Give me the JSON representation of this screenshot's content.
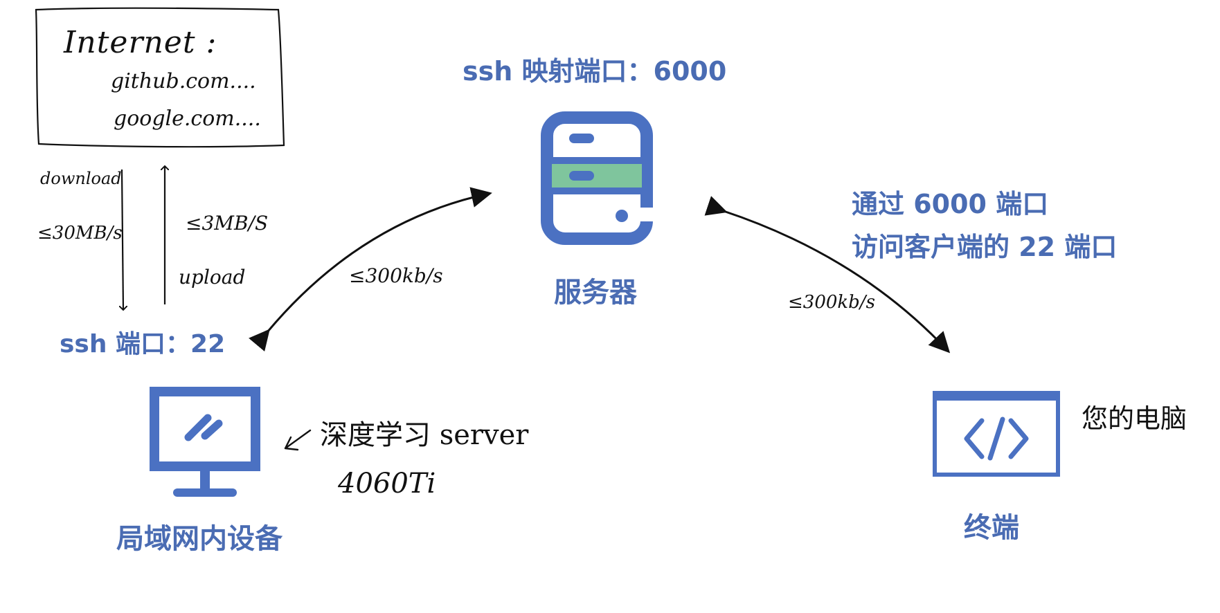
{
  "internet_box": {
    "title": "Internet :",
    "sites": [
      "github.com....",
      "google.com...."
    ]
  },
  "links": {
    "download_label": "download",
    "download_speed": "≤30MB/s",
    "upload_speed": "≤3MB/S",
    "upload_label": "upload",
    "left_link_speed": "≤300kb/s",
    "right_link_speed": "≤300kb/s"
  },
  "server": {
    "mapped_port": "ssh 映射端口：6000",
    "name": "服务器"
  },
  "lan_device": {
    "port": "ssh 端口：22",
    "name": "局域网内设备",
    "note": "深度学习 server",
    "gpu": "4060Ti"
  },
  "terminal": {
    "access_line_1": "通过 6000 端口",
    "access_line_2": "访问客户端的 22 端口",
    "name": "终端",
    "note": "您的电脑"
  },
  "colors": {
    "blue": "#4a6cb3",
    "icon_blue": "#4b71c2",
    "green": "#7fc59d",
    "ink": "#111111"
  }
}
